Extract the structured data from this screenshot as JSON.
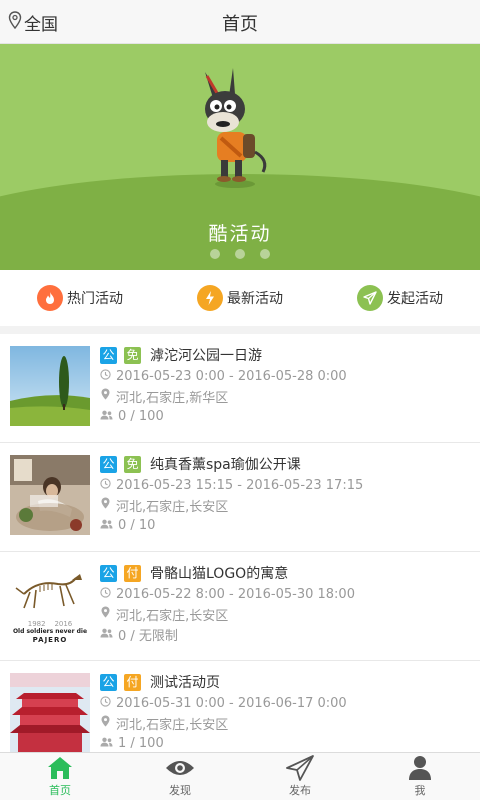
{
  "header": {
    "location": "全国",
    "title": "首页"
  },
  "banner": {
    "caption": "酷活动",
    "slides": 3
  },
  "quick_actions": [
    {
      "label": "热门活动",
      "color": "#ff6f3d"
    },
    {
      "label": "最新活动",
      "color": "#f5a623"
    },
    {
      "label": "发起活动",
      "color": "#8cc152"
    }
  ],
  "activities": [
    {
      "tag_type": "公",
      "tag_price": "免",
      "title": "滹沱河公园一日游",
      "time": "2016-05-23 0:00 - 2016-05-28 0:00",
      "place": "河北,石家庄,新华区",
      "count": "0 / 100"
    },
    {
      "tag_type": "公",
      "tag_price": "免",
      "title": "纯真香薰spa瑜伽公开课",
      "time": "2016-05-23 15:15 - 2016-05-23 17:15",
      "place": "河北,石家庄,长安区",
      "count": "0 / 10"
    },
    {
      "tag_type": "公",
      "tag_price": "付",
      "title": "骨骼山猫LOGO的寓意",
      "time": "2016-05-22 8:00 - 2016-05-30 18:00",
      "place": "河北,石家庄,长安区",
      "count": "0 / 无限制",
      "thumb_text": "Old soldiers never die",
      "thumb_text2": "PAJERO",
      "thumb_years": "1982    2016"
    },
    {
      "tag_type": "公",
      "tag_price": "付",
      "title": "测试活动页",
      "time": "2016-05-31 0:00 - 2016-06-17 0:00",
      "place": "河北,石家庄,长安区",
      "count": "1 / 100"
    }
  ],
  "tabbar": [
    {
      "label": "首页",
      "active": true
    },
    {
      "label": "发现"
    },
    {
      "label": "发布"
    },
    {
      "label": "我"
    }
  ],
  "colors": {
    "accent": "#2bbd5b",
    "banner": "#9ccb65"
  }
}
